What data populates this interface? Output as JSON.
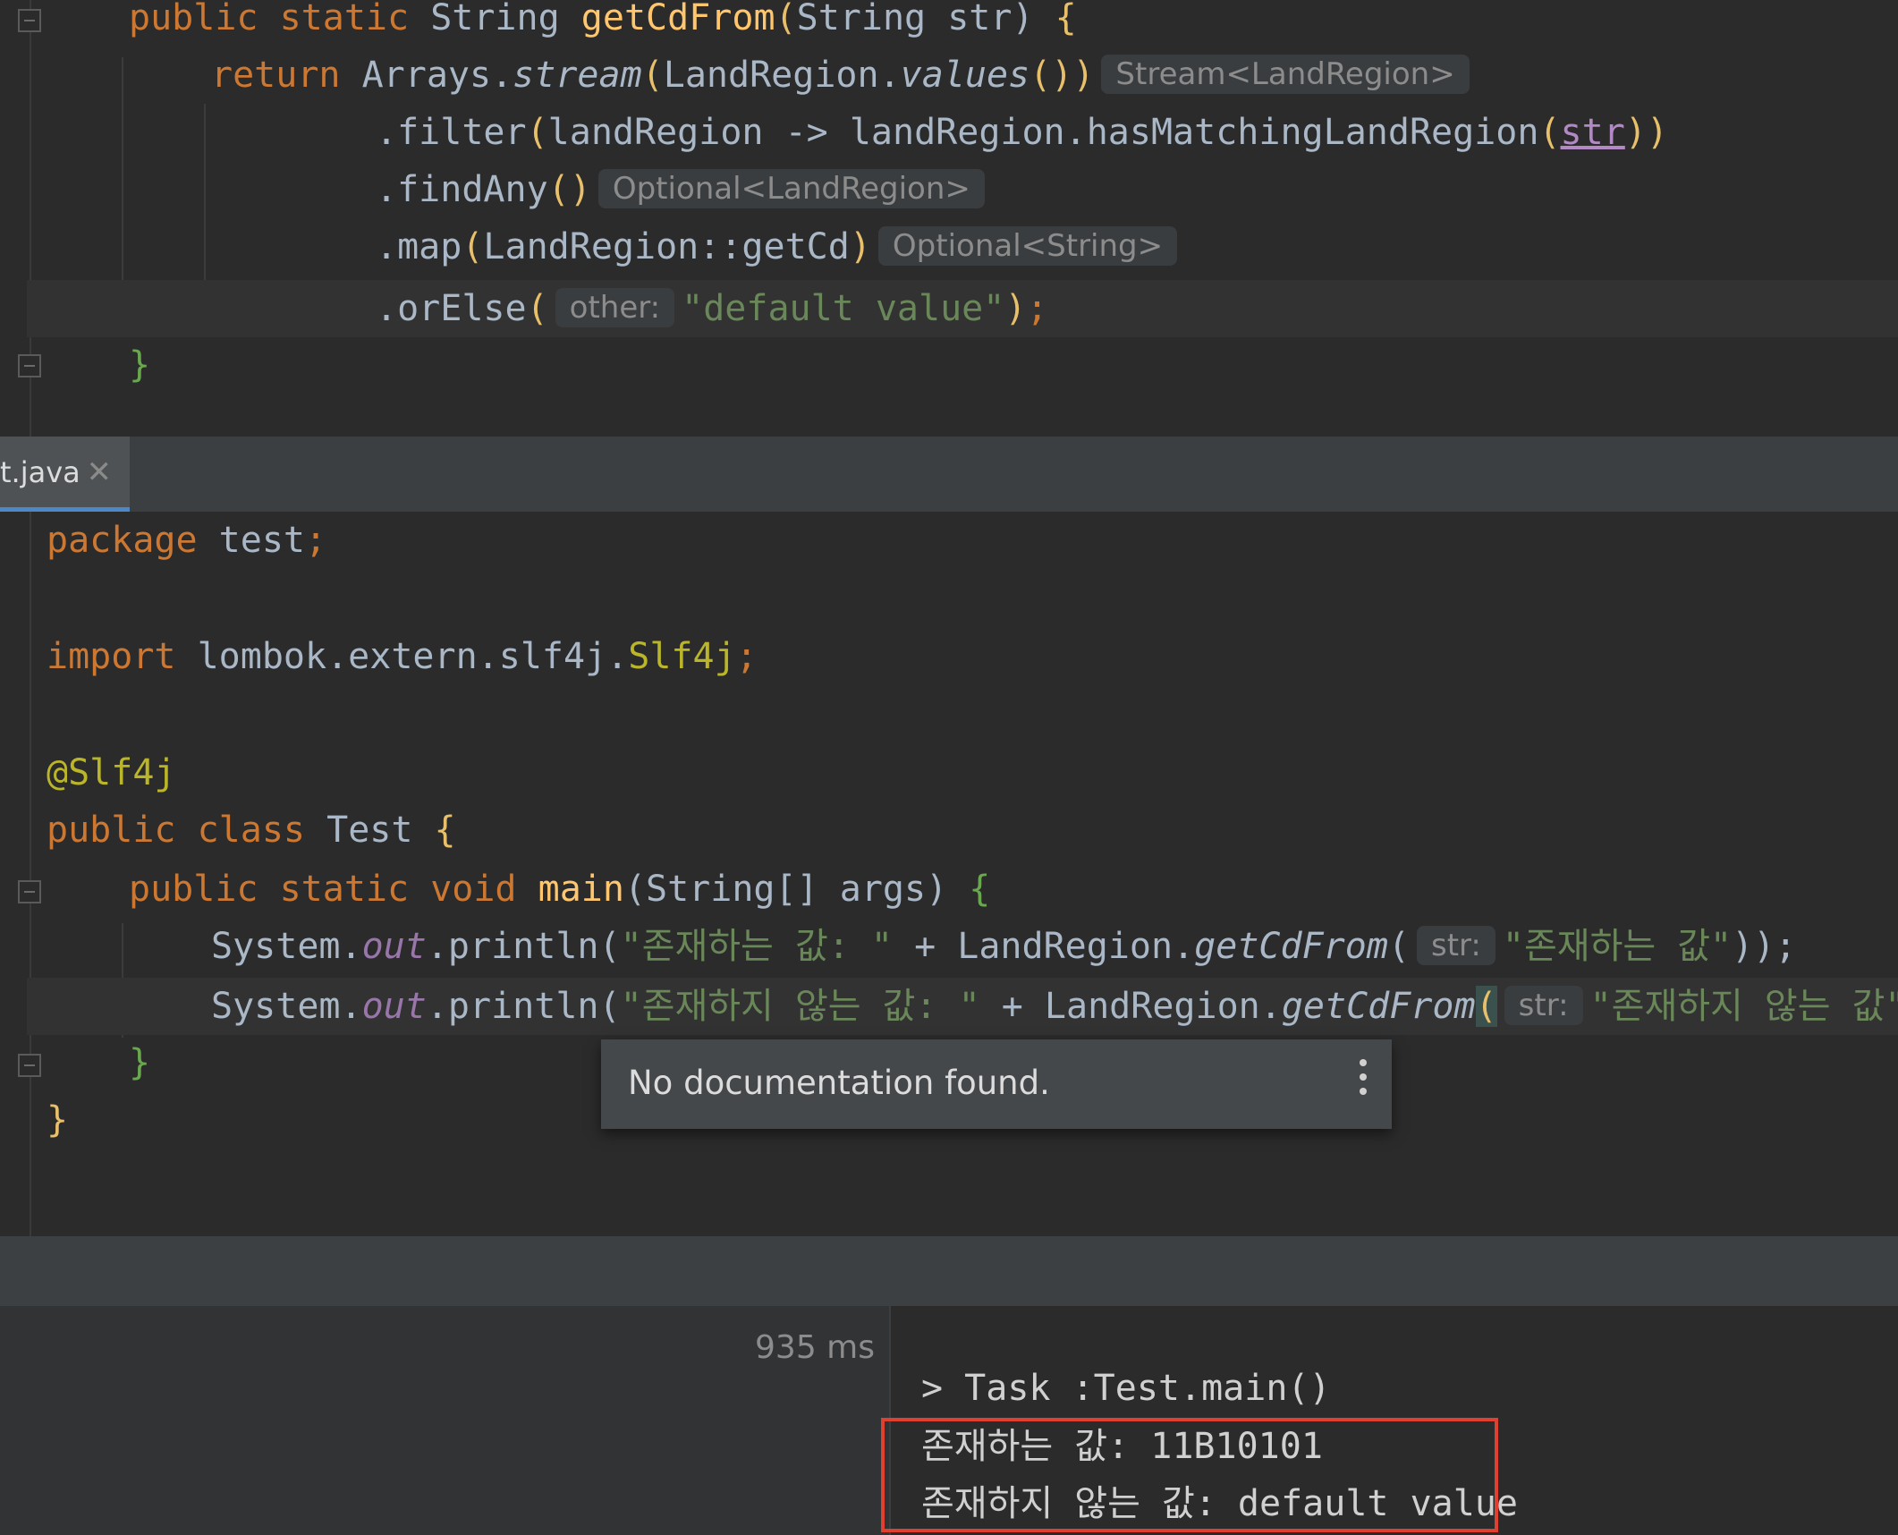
{
  "top_editor": {
    "line_signature": [
      "public",
      "static",
      "String",
      "getCdFrom",
      "(",
      "String",
      " str) ",
      "{"
    ],
    "return_kw": "return",
    "arrays": "Arrays.",
    "stream_call": "stream",
    "landregion_values": "LandRegion.",
    "values_call": "values",
    "hint_stream": "Stream<LandRegion>",
    "filter_line": ".filter",
    "filter_arg": "landRegion -> landRegion.hasMatchingLandRegion",
    "filter_param": "str",
    "findany_line": ".findAny",
    "hint_optional_landregion": "Optional<LandRegion>",
    "map_line": ".map",
    "map_arg": "LandRegion::getCd",
    "hint_optional_string": "Optional<String>",
    "orelse_line": ".orElse",
    "hint_other": "other:",
    "default_value": "\"default value\"",
    "close_brace": "}"
  },
  "tab": {
    "label": "t.java",
    "close": "✕"
  },
  "bottom_editor": {
    "package_kw": "package",
    "package_name": "test",
    "import_kw": "import",
    "import_path": "lombok.extern.slf4j.",
    "import_class": "Slf4j",
    "annotation": "@Slf4j",
    "public_kw": "public",
    "class_kw": "class",
    "class_name": "Test",
    "static_kw": "static",
    "void_kw": "void",
    "main_name": "main",
    "main_params": "(String[] args) ",
    "system": "System.",
    "out": "out",
    "println": ".println(",
    "str_exists_label": "\"존재하는 값: \"",
    "str_not_exists_label": "\"존재하지 않는 값: \"",
    "plus_landregion": " + LandRegion.",
    "getcdfrom": "getCdFrom",
    "hint_str": "str:",
    "arg_exists": "\"존재하는 값\"",
    "arg_not_exists": "\"존재하지 않는 값\"",
    "close_brace": "}"
  },
  "popup": {
    "text": "No documentation found."
  },
  "run": {
    "duration": "935 ms",
    "task_line": "> Task :Test.main()",
    "output_1": "존재하는 값: 11B10101",
    "output_2": "존재하지 않는 값: default value"
  },
  "colors": {
    "keyword": "#cc7832",
    "method": "#ffc66d",
    "string": "#6a8759",
    "highlight_box": "#e0402f"
  }
}
